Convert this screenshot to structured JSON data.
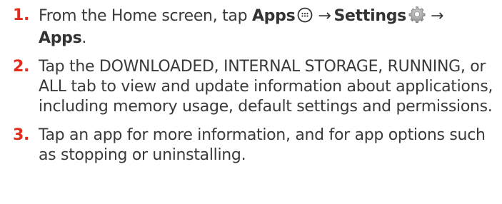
{
  "steps": [
    {
      "number": "1.",
      "text_before": "From the Home screen, tap ",
      "apps_label": "Apps",
      "apps_icon": "apps-grid-icon",
      "arrow1": "→",
      "settings_label": "Settings",
      "settings_icon": "gear-icon",
      "arrow2": "→",
      "apps_label2": "Apps",
      "text_after": "."
    },
    {
      "number": "2.",
      "text": "Tap the DOWNLOADED, INTERNAL STORAGE, RUNNING, or ALL tab to view and update information about applications, including memory usage, default settings and permissions."
    },
    {
      "number": "3.",
      "text": "Tap an app for more information, and for app options such as stopping or uninstalling."
    }
  ],
  "colors": {
    "accent": "#e42c1c",
    "text": "#3a3a3a"
  }
}
